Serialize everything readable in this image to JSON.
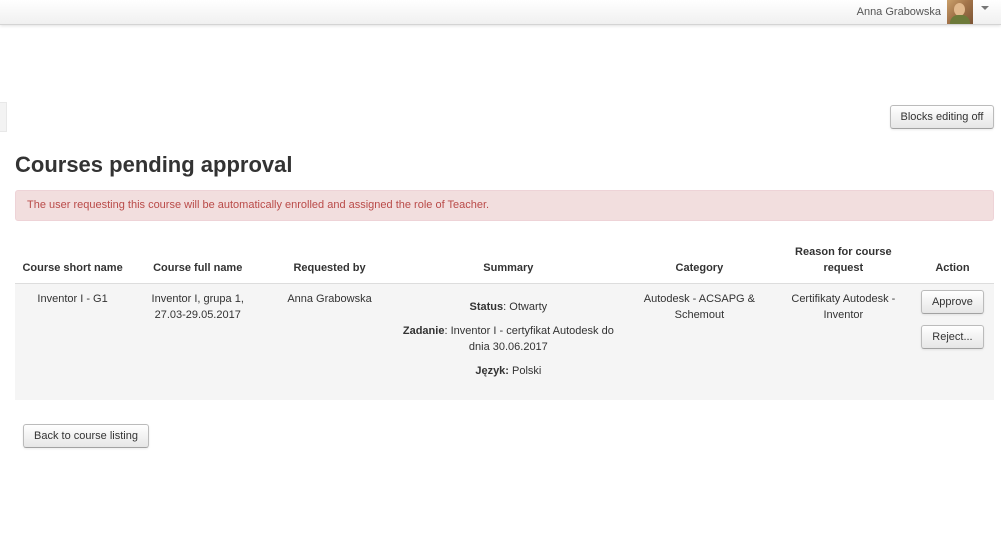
{
  "header": {
    "user_name": "Anna Grabowska",
    "avatar_icon": "user-avatar",
    "menu_icon": "caret-down-icon"
  },
  "editing": {
    "blocks_button": "Blocks editing off"
  },
  "page": {
    "title": "Courses pending approval",
    "alert": "The user requesting this course will be automatically enrolled and assigned the role of Teacher."
  },
  "table": {
    "headers": {
      "short_name": "Course short name",
      "full_name": "Course full name",
      "requested_by": "Requested by",
      "summary": "Summary",
      "category": "Category",
      "reason": "Reason for course request",
      "action": "Action"
    },
    "rows": [
      {
        "short_name": "Inventor I - G1",
        "full_name": "Inventor I, grupa 1, 27.03-29.05.2017",
        "requested_by": "Anna Grabowska",
        "summary": {
          "status_label": "Status",
          "status_value": ": Otwarty",
          "task_label": "Zadanie",
          "task_value": ": Inventor I - certyfikat Autodesk do dnia 30.06.2017",
          "language_label": "Język:",
          "language_value": " Polski"
        },
        "category": "Autodesk - ACSAPG & Schemout",
        "reason": "Certifikaty Autodesk - Inventor",
        "approve": "Approve",
        "reject": "Reject..."
      }
    ]
  },
  "footer": {
    "back_button": "Back to course listing"
  },
  "colors": {
    "alert_bg": "#f2dede",
    "alert_text": "#b94a48",
    "row_bg": "#f5f5f5"
  }
}
